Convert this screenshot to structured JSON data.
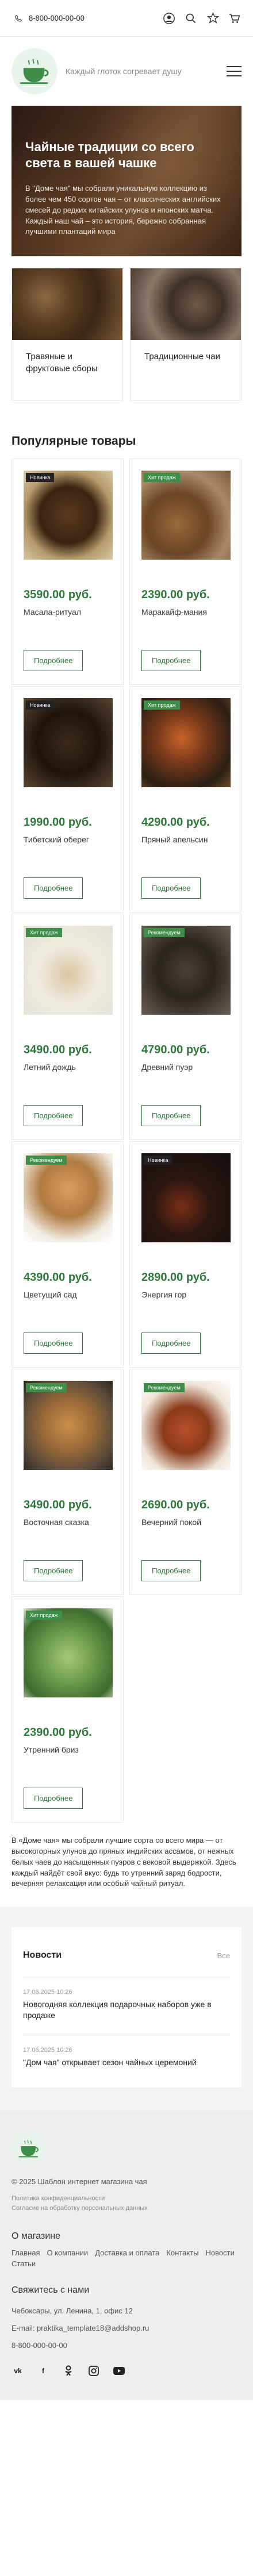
{
  "topbar": {
    "phone": "8-800-000-00-00",
    "cart_count": "0"
  },
  "header": {
    "slogan": "Каждый глоток согревает душу"
  },
  "hero": {
    "title": "Чайные традиции со всего света в вашей чашке",
    "text": "В \"Доме чая\" мы собрали уникальную коллекцию из более чем 450 сортов чая – от классических английских смесей до редких китайских улунов и японских матча. Каждый наш чай – это история, бережно собранная лучшими плантаций мира"
  },
  "categories": [
    {
      "label": "Травяные и фруктовые сборы"
    },
    {
      "label": "Традиционные чаи"
    }
  ],
  "popular": {
    "title": "Популярные товары",
    "more_label": "Подробнее",
    "products": [
      {
        "name": "Масала-ритуал",
        "price": "3590.00 руб.",
        "badge": "Новинка",
        "badge_type": "new"
      },
      {
        "name": "Маракайф-мания",
        "price": "2390.00 руб.",
        "badge": "Хит продаж",
        "badge_type": "hit"
      },
      {
        "name": "Тибетский оберег",
        "price": "1990.00 руб.",
        "badge": "Новинка",
        "badge_type": "new"
      },
      {
        "name": "Пряный апельсин",
        "price": "4290.00 руб.",
        "badge": "Хит продаж",
        "badge_type": "hit"
      },
      {
        "name": "Летний дождь",
        "price": "3490.00 руб.",
        "badge": "Хит продаж",
        "badge_type": "hit"
      },
      {
        "name": "Древний пуэр",
        "price": "4790.00 руб.",
        "badge": "Рекомендуем",
        "badge_type": "rec"
      },
      {
        "name": "Цветущий сад",
        "price": "4390.00 руб.",
        "badge": "Рекомендуем",
        "badge_type": "rec"
      },
      {
        "name": "Энергия гор",
        "price": "2890.00 руб.",
        "badge": "Новинка",
        "badge_type": "new"
      },
      {
        "name": "Восточная сказка",
        "price": "3490.00 руб.",
        "badge": "Рекомендуем",
        "badge_type": "rec"
      },
      {
        "name": "Вечерний покой",
        "price": "2690.00 руб.",
        "badge": "Рекомендуем",
        "badge_type": "rec"
      },
      {
        "name": "Утренний бриз",
        "price": "2390.00 руб.",
        "badge": "Хит продаж",
        "badge_type": "hit"
      }
    ]
  },
  "about": "В «Доме чая» мы собрали лучшие сорта со всего мира — от высокогорных улунов до пряных индийских ассамов, от нежных белых чаев до насыщенных пуэров с вековой выдержкой. Здесь каждый найдёт свой вкус: будь то утренний заряд бодрости, вечерняя релаксация или особый чайный ритуал.",
  "news": {
    "title": "Новости",
    "all_label": "Все",
    "items": [
      {
        "date": "17.06.2025 10:26",
        "text": "Новогодняя коллекция подарочных наборов уже в продаже"
      },
      {
        "date": "17.06.2025 10:26",
        "text": "\"Дом чая\" открывает сезон чайных церемоний"
      }
    ]
  },
  "footer": {
    "copyright": "© 2025 Шаблон интернет магазина чая",
    "privacy": "Политика конфиденциальности",
    "consent": "Согласие на обработку персональных данных",
    "store_title": "О магазине",
    "menu": [
      "Главная",
      "О компании",
      "Доставка и оплата",
      "Контакты",
      "Новости",
      "Статьи"
    ],
    "contact_title": "Свяжитесь с нами",
    "address": "Чебоксары, ул. Ленина, 1, офис 12",
    "email": "E-mail: praktika_template18@addshop.ru",
    "phone": "8-800-000-00-00",
    "socials": [
      "vk",
      "facebook",
      "odnoklassniki",
      "instagram",
      "youtube"
    ]
  },
  "colors": {
    "accent": "#2f7a3a",
    "hit_badge": "#3e8e4a",
    "new_badge": "#222222"
  }
}
